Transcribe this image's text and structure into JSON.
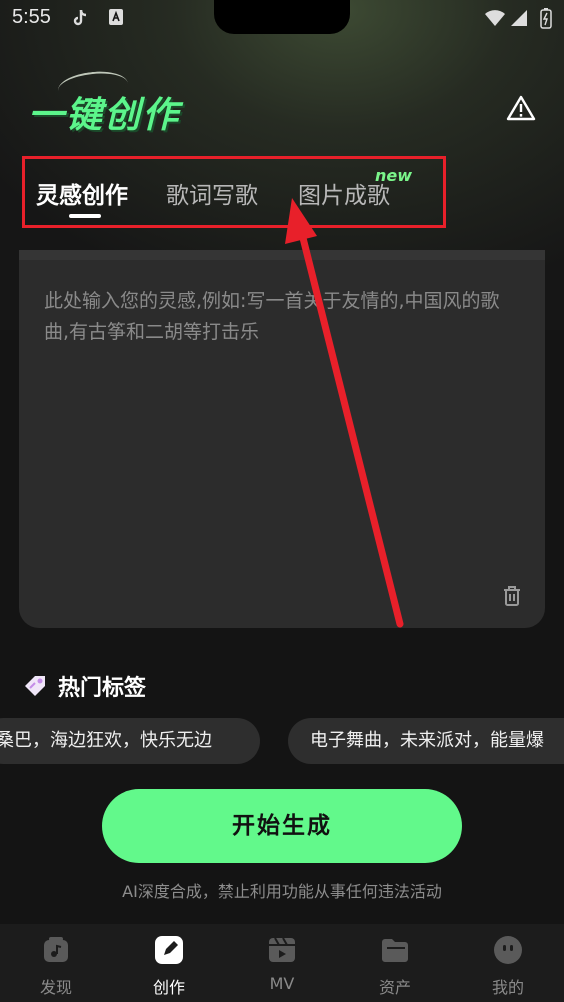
{
  "status_bar": {
    "time": "5:55"
  },
  "header": {
    "title": "一键创作"
  },
  "tabs": [
    {
      "label": "灵感创作"
    },
    {
      "label": "歌词写歌"
    },
    {
      "label": "图片成歌",
      "badge": "new"
    }
  ],
  "input": {
    "placeholder": "此处输入您的灵感,例如:写一首关于友情的,中国风的歌曲,有古筝和二胡等打击乐"
  },
  "hot_tags": {
    "title": "热门标签",
    "items": [
      "桑巴，海边狂欢，快乐无边",
      "电子舞曲，未来派对，能量爆"
    ]
  },
  "start_button": {
    "label": "开始生成"
  },
  "disclaimer": "AI深度合成，禁止利用功能从事任何违法活动",
  "nav": [
    {
      "label": "发现",
      "icon": "discover-icon"
    },
    {
      "label": "创作",
      "icon": "create-icon"
    },
    {
      "label": "MV",
      "icon": "mv-icon"
    },
    {
      "label": "资产",
      "icon": "assets-icon"
    },
    {
      "label": "我的",
      "icon": "profile-icon"
    }
  ],
  "colors": {
    "accent": "#62f98b",
    "annotation": "#e8202a"
  }
}
